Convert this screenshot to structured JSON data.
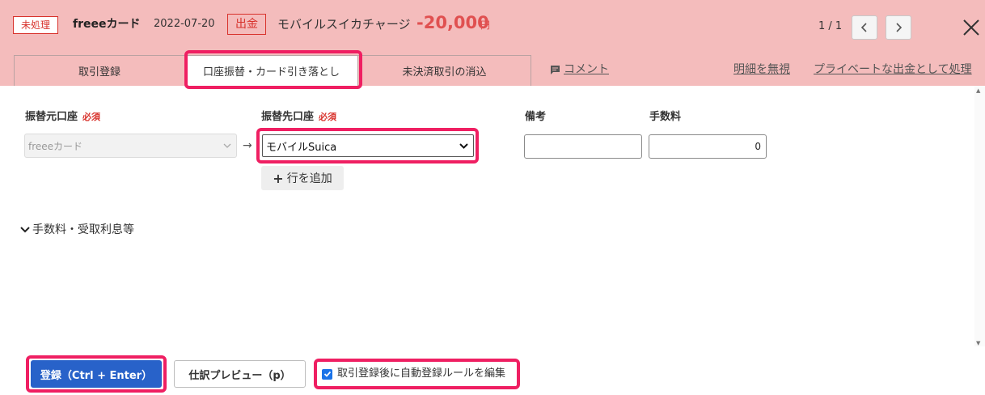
{
  "header": {
    "status_badge": "未処理",
    "card_name": "freeeカード",
    "date": "2022-07-20",
    "type_badge": "出金",
    "description": "モバイルスイカチャージ",
    "amount": "-20,000",
    "currency": "円",
    "pager": "1 / 1",
    "icons": {
      "prev": "chevron-left-icon",
      "next": "chevron-right-icon",
      "close": "close-icon"
    }
  },
  "tabs": [
    {
      "label": "取引登録"
    },
    {
      "label": "口座振替・カード引き落とし"
    },
    {
      "label": "未決済取引の消込"
    }
  ],
  "links": {
    "comment": "コメント",
    "ignore": "明細を無視",
    "private": "プライベートな出金として処理"
  },
  "form": {
    "from_label": "振替元口座",
    "from_required": "必須",
    "from_value": "freeeカード",
    "to_label": "振替先口座",
    "to_required": "必須",
    "to_value": "モバイルSuica",
    "arrow": "→",
    "memo_label": "備考",
    "memo_value": "",
    "fee_label": "手数料",
    "fee_value": "0",
    "add_row_plus": "+",
    "add_row": "行を追加",
    "fee_section": "手数料・受取利息等"
  },
  "footer": {
    "register": "登録（Ctrl + Enter）",
    "preview": "仕訳プレビュー（p）",
    "auto_rule": "取引登録後に自動登録ルールを編集",
    "auto_rule_checked": true
  },
  "colors": {
    "header_bg": "#f4bcbc",
    "accent_red": "#d8322c",
    "amount_red": "#e05050",
    "primary_blue": "#2862c9",
    "highlight_pink": "#ef1f62"
  }
}
